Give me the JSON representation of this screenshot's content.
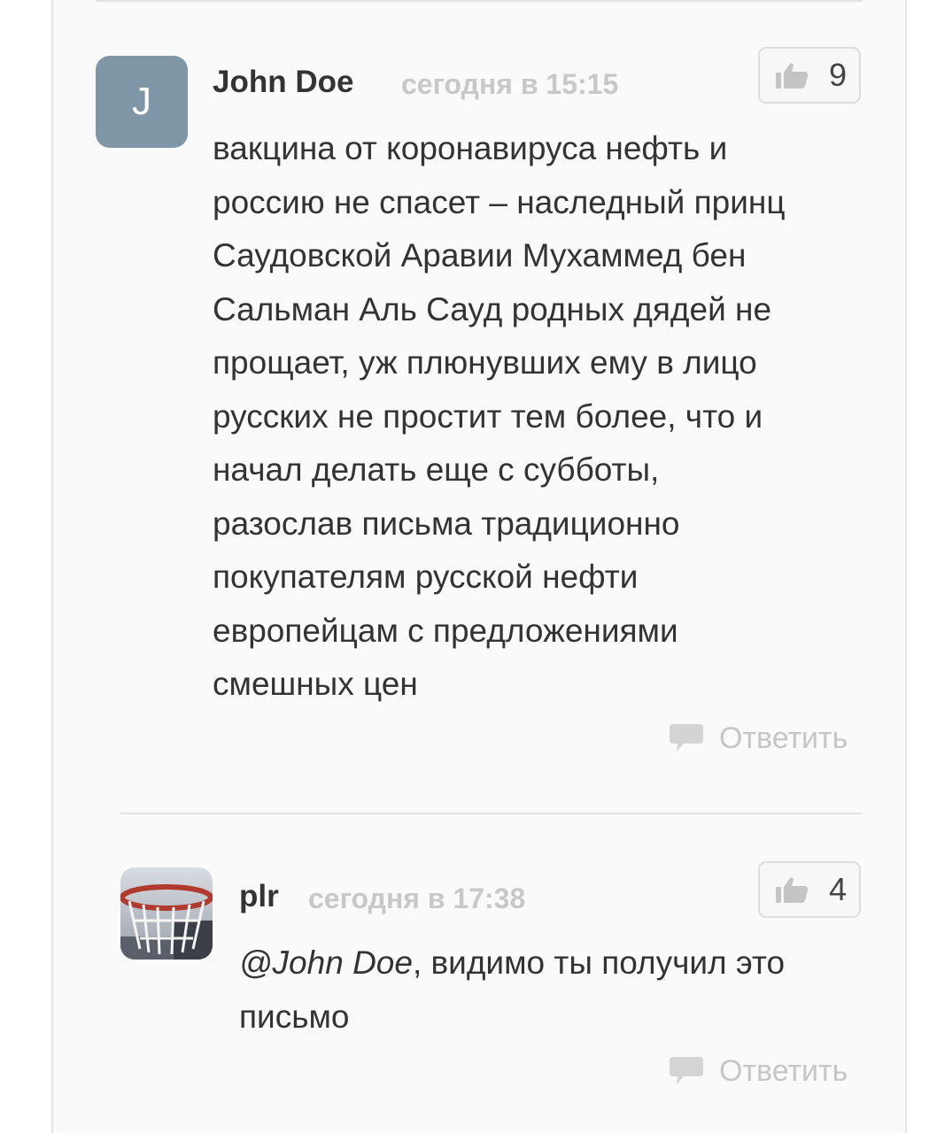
{
  "comments": [
    {
      "avatar_letter": "J",
      "author": "John Doe",
      "timestamp": "сегодня в 15:15",
      "likes": "9",
      "lines": [
        "вакцина от коронавируса нефть и",
        "россию не спасет – наследный принц",
        "Саудовской Аравии Мухаммед бен",
        "Сальман Аль Сауд родных дядей не",
        "прощает, уж плюнувших ему в лицо",
        "русских не простит тем более, что и",
        "начал делать еще с субботы,",
        "разослав письма традиционно",
        "покупателям русской нефти",
        "европейцам с предложениями",
        "смешных цен"
      ],
      "reply_label": "Ответить"
    },
    {
      "author": "plr",
      "timestamp": "сегодня в 17:38",
      "likes": "4",
      "mention": "@John Doe",
      "line1_rest": ", видимо ты получил это",
      "line2": "письмо",
      "reply_label": "Ответить"
    }
  ],
  "icons": {
    "like": "thumbs-up-icon",
    "reply": "speech-bubble-icon"
  },
  "colors": {
    "avatar_bg": "#7f96a6",
    "muted": "#c8c8c8",
    "text": "#333333"
  }
}
